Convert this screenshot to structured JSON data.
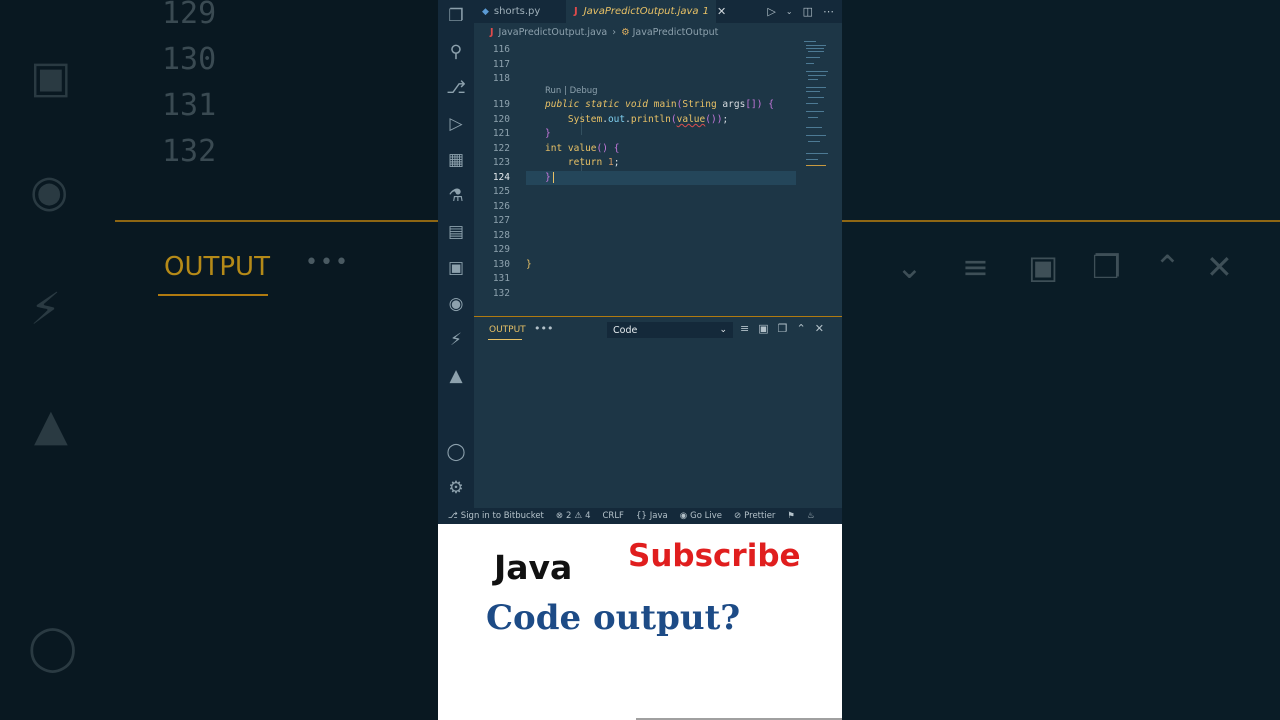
{
  "background_echo": {
    "line_numbers": [
      "129",
      "130",
      "131",
      "132"
    ],
    "output_label": "OUTPUT",
    "dots": "•••"
  },
  "tabs": [
    {
      "label": "shorts.py",
      "active": false
    },
    {
      "label": "JavaPredictOutput.java",
      "active": true,
      "badge": "1"
    }
  ],
  "tab_lang_glyph": "J",
  "breadcrumb": {
    "file": "JavaPredictOutput.java",
    "symbol": "JavaPredictOutput"
  },
  "editor": {
    "line_numbers": [
      "116",
      "117",
      "118",
      "119",
      "120",
      "121",
      "122",
      "123",
      "124",
      "125",
      "126",
      "127",
      "128",
      "129",
      "130",
      "131",
      "132"
    ],
    "codelens": "Run | Debug",
    "current_line": "124"
  },
  "panel": {
    "tab_label": "OUTPUT",
    "dots": "•••",
    "select_value": "Code"
  },
  "statusbar": {
    "bitbucket": "Sign in to Bitbucket",
    "errors": "2",
    "warnings": "4",
    "eol": "CRLF",
    "language": "Java",
    "golive": "Go Live",
    "prettier": "Prettier"
  },
  "promo": {
    "language": "Java",
    "subscribe": "Subscribe",
    "question": "Code output?"
  },
  "colors": {
    "editor_bg": "#1d3646",
    "accent": "#e8c166",
    "panel_border": "#b07a10",
    "subscribe_red": "#e01e1e",
    "question_blue": "#1d4b86"
  }
}
